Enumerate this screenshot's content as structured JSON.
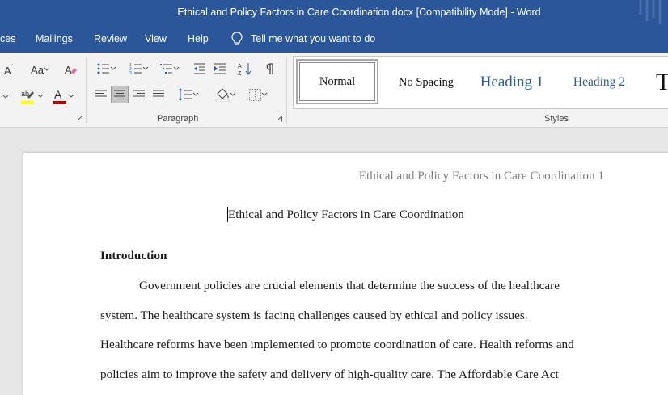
{
  "titlebar": {
    "title": "Ethical and Policy Factors in Care Coordination.docx [Compatibility Mode]  -  Word"
  },
  "menu": {
    "tabs": [
      "ces",
      "Mailings",
      "Review",
      "View",
      "Help"
    ],
    "tell_me": "Tell me what you want to do"
  },
  "ribbon": {
    "font_case_label": "Aa",
    "paragraph_label": "Paragraph",
    "styles_label": "Styles",
    "styles": [
      "Normal",
      "No Spacing",
      "Heading 1",
      "Heading 2",
      "T"
    ]
  },
  "document": {
    "header": "Ethical and Policy Factors in Care Coordination 1",
    "title": "Ethical and Policy Factors in Care Coordination",
    "section_heading": "Introduction",
    "lines": [
      "Government policies are crucial elements that determine the success of the healthcare",
      "system. The healthcare system is facing challenges caused by ethical and policy issues.",
      "Healthcare reforms have been implemented to promote coordination of care. Health reforms and",
      "policies aim to improve the safety and delivery of high-quality care. The Affordable Care Act"
    ]
  },
  "colors": {
    "word_blue": "#2b579a",
    "ribbon_bg": "#f3f3f3",
    "highlight_yellow": "#ffff00",
    "font_color_red": "#c00000",
    "heading_blue": "#2e5c8a"
  }
}
